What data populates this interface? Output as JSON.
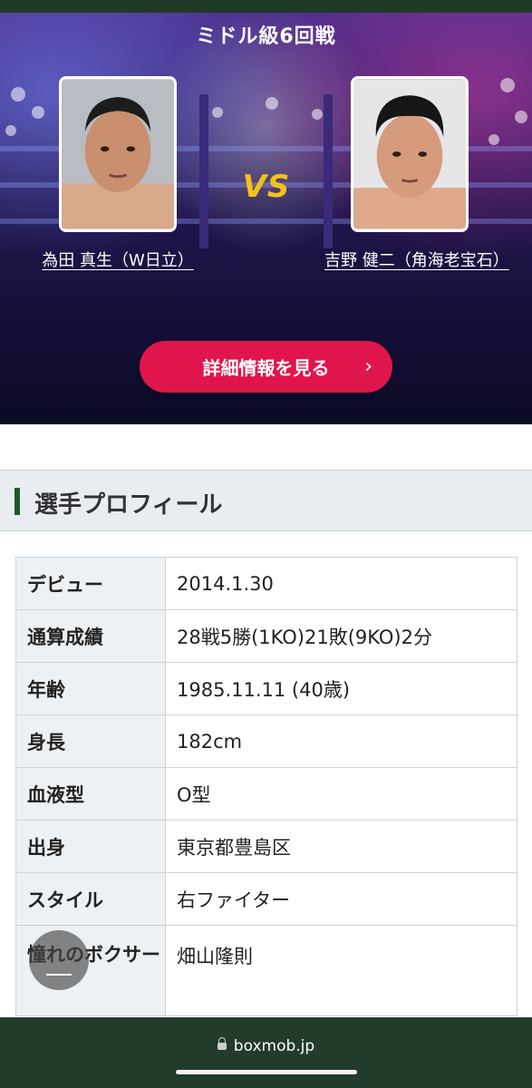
{
  "bout": {
    "title": "ミドル級6回戦",
    "vs": "VS",
    "left_fighter": "為田 真生（W日立）",
    "right_fighter": "吉野 健二（角海老宝石）",
    "detail_button": "詳細情報を見る",
    "detail_arrow": "›"
  },
  "profile": {
    "heading": "選手プロフィール",
    "rows": [
      {
        "label": "デビュー",
        "value": "2014.1.30"
      },
      {
        "label": "通算成績",
        "value": "28戦5勝(1KO)21敗(9KO)2分"
      },
      {
        "label": "年齢",
        "value": "1985.11.11 (40歳)"
      },
      {
        "label": "身長",
        "value": "182cm"
      },
      {
        "label": "血液型",
        "value": "O型"
      },
      {
        "label": "出身",
        "value": "東京都豊島区"
      },
      {
        "label": "スタイル",
        "value": "右ファイター"
      },
      {
        "label": "憧れのボクサー",
        "value": "畑山隆則"
      }
    ]
  },
  "browser": {
    "url": "boxmob.jp"
  },
  "colors": {
    "accent": "#e0154d",
    "vs": "#f3c21a",
    "header_bar": "#1d5a2c",
    "bottom_bar": "#233b2a"
  }
}
